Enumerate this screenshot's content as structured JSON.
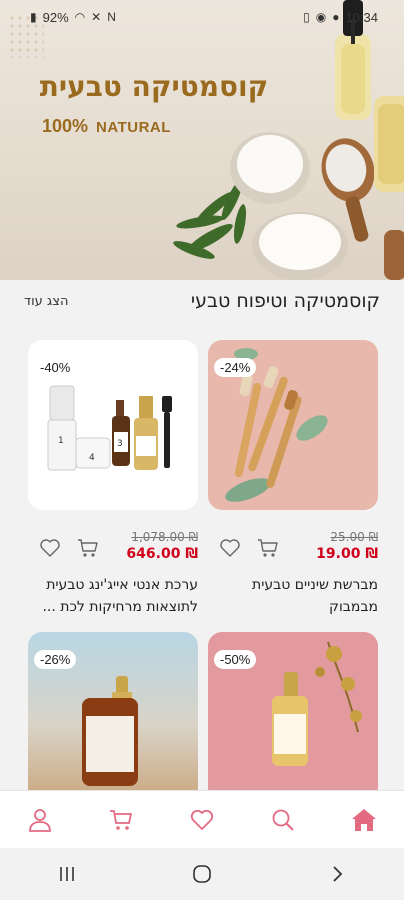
{
  "status_bar": {
    "battery": "92%",
    "time": "10:34"
  },
  "banner": {
    "title": "קוסמטיקה טבעית",
    "subtitle_percent": "100%",
    "subtitle_word": "NATURAL"
  },
  "section": {
    "title": "קוסמטיקה וטיפוח טבעי",
    "show_more": "הצג עוד"
  },
  "products": [
    {
      "discount": "-24%",
      "old_price": "₪ 25.00",
      "new_price": "₪ 19.00",
      "name_line1": "מברשת שיניים טבעית",
      "name_line2": "מבמבוק"
    },
    {
      "discount": "-40%",
      "old_price": "₪ 1,078.00",
      "new_price": "₪ 646.00",
      "name_line1": "ערכת אנטי אייג'ינג טבעית",
      "name_line2": "לתוצאות מרחיקות לכת ..."
    },
    {
      "discount": "-50%"
    },
    {
      "discount": "-26%"
    }
  ],
  "bottom_nav": {
    "items": [
      "home-icon",
      "search-icon",
      "heart-icon",
      "cart-icon",
      "user-icon"
    ],
    "accent": "#e46a82"
  },
  "system_bar": {
    "items": [
      "recents-icon",
      "home-circle-icon",
      "back-icon"
    ]
  }
}
